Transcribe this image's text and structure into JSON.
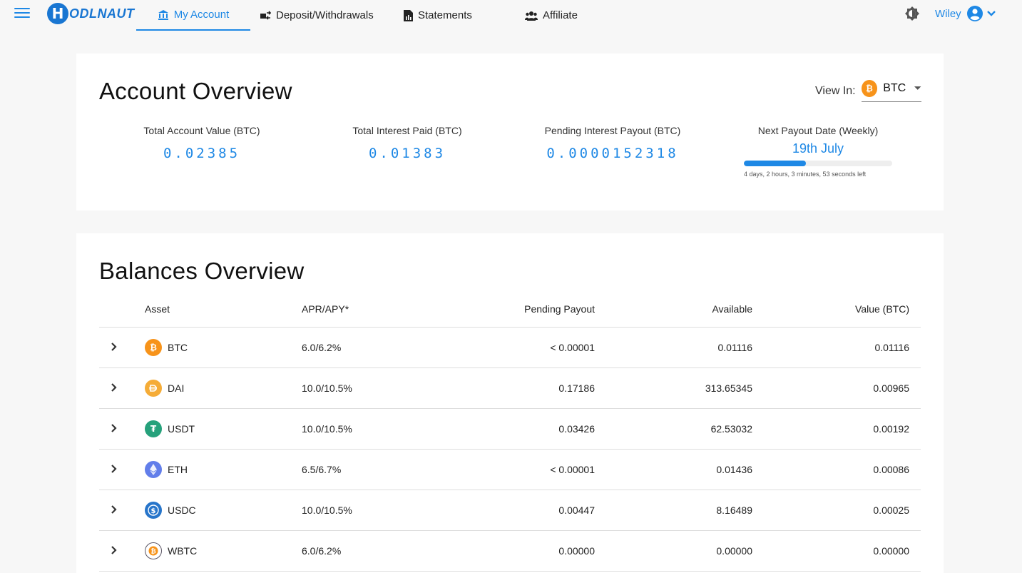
{
  "nav": {
    "logo_letter": "H",
    "logo_text": "ODLNAUT",
    "tabs": [
      {
        "label": "My Account"
      },
      {
        "label": "Deposit/Withdrawals"
      },
      {
        "label": "Statements"
      },
      {
        "label": "Affiliate"
      }
    ],
    "user_name": "Wiley"
  },
  "account": {
    "title": "Account Overview",
    "view_in_label": "View In:",
    "currency": "BTC",
    "stats": [
      {
        "label": "Total Account Value (BTC)",
        "value": "0.02385"
      },
      {
        "label": "Total Interest Paid (BTC)",
        "value": "0.01383"
      },
      {
        "label": "Pending Interest Payout (BTC)",
        "value": "0.0000152318"
      }
    ],
    "payout": {
      "label": "Next Payout Date (Weekly)",
      "date": "19th July",
      "progress": 0.42,
      "remaining": "4 days, 2 hours, 3 minutes, 53 seconds left"
    }
  },
  "balances": {
    "title": "Balances Overview",
    "headers": {
      "asset": "Asset",
      "apr": "APR/APY*",
      "pending": "Pending Payout",
      "available": "Available",
      "value": "Value (BTC)"
    },
    "rows": [
      {
        "asset": "BTC",
        "apr": "6.0/6.2%",
        "pending": "< 0.00001",
        "available": "0.01116",
        "value": "0.01116"
      },
      {
        "asset": "DAI",
        "apr": "10.0/10.5%",
        "pending": "0.17186",
        "available": "313.65345",
        "value": "0.00965"
      },
      {
        "asset": "USDT",
        "apr": "10.0/10.5%",
        "pending": "0.03426",
        "available": "62.53032",
        "value": "0.00192"
      },
      {
        "asset": "ETH",
        "apr": "6.5/6.7%",
        "pending": "< 0.00001",
        "available": "0.01436",
        "value": "0.00086"
      },
      {
        "asset": "USDC",
        "apr": "10.0/10.5%",
        "pending": "0.00447",
        "available": "8.16489",
        "value": "0.00025"
      },
      {
        "asset": "WBTC",
        "apr": "6.0/6.2%",
        "pending": "0.00000",
        "available": "0.00000",
        "value": "0.00000"
      }
    ]
  },
  "colors": {
    "accent": "#1e88e5",
    "btc": "#f7931a",
    "dai": "#f5ac37",
    "usdt": "#26a17b",
    "eth": "#627eea",
    "usdc": "#2775ca",
    "wbtc": "#5a5564"
  }
}
